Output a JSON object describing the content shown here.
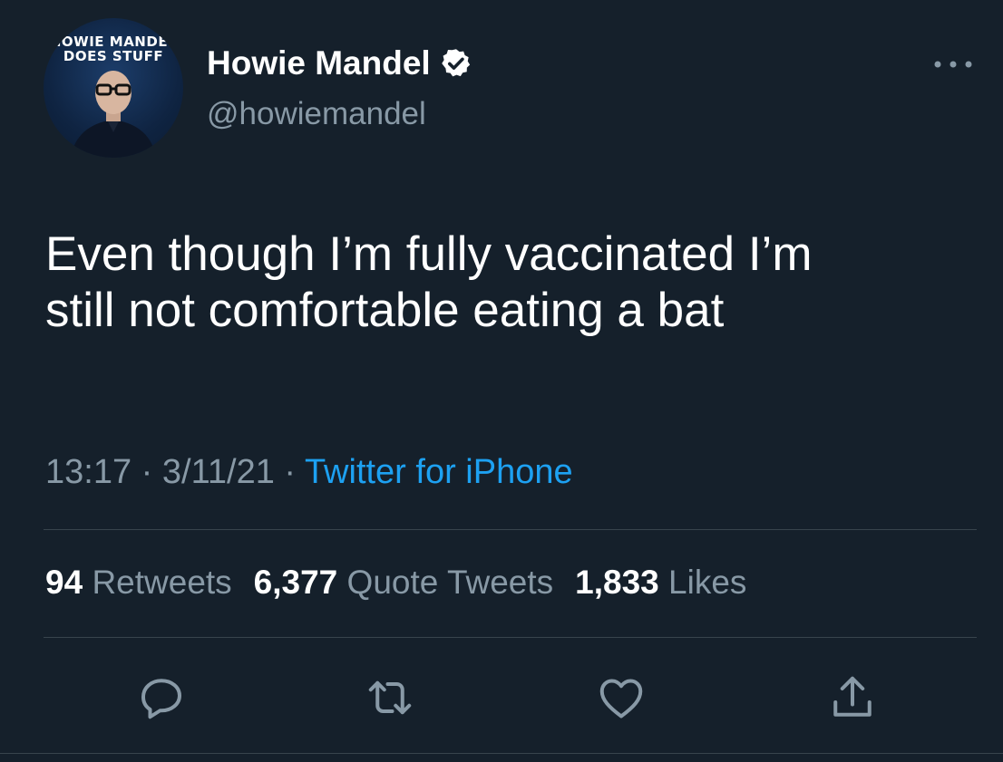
{
  "author": {
    "display_name": "Howie Mandel",
    "handle": "@howiemandel",
    "verified": true,
    "avatar_logo_line1": "HOWIE MANDEL",
    "avatar_logo_line2": "DOES STUFF"
  },
  "tweet": {
    "text_line1": "Even though I’m fully vaccinated I’m",
    "text_line2": "still not comfortable eating a bat",
    "time": "13:17",
    "date": "3/11/21",
    "separator": " · ",
    "source": "Twitter for iPhone"
  },
  "stats": {
    "retweets_count": "94",
    "retweets_label": "Retweets",
    "quotes_count": "6,377",
    "quotes_label": "Quote Tweets",
    "likes_count": "1,833",
    "likes_label": "Likes"
  },
  "icons": {
    "more": "more-dots-icon",
    "verified": "verified-badge-icon",
    "reply": "reply-icon",
    "retweet": "retweet-icon",
    "like": "heart-icon",
    "share": "share-icon"
  },
  "colors": {
    "background": "#15202b",
    "secondary_text": "#8899a6",
    "accent": "#1da1f2",
    "divider": "#38444d"
  }
}
